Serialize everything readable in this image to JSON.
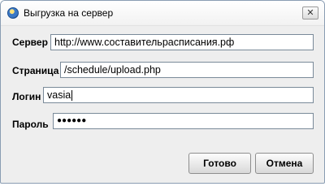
{
  "window": {
    "title": "Выгрузка на сервер",
    "close_symbol": "✕",
    "icon": "app-globe-icon"
  },
  "form": {
    "server": {
      "label": "Сервер",
      "value": "http://www.составительрасписания.рф"
    },
    "page": {
      "label": "Страница",
      "value": "/schedule/upload.php"
    },
    "login": {
      "label": "Логин",
      "value": "vasia"
    },
    "password": {
      "label": "Пароль",
      "value": "●●●●●●"
    }
  },
  "buttons": {
    "ok": "Готово",
    "cancel": "Отмена"
  }
}
